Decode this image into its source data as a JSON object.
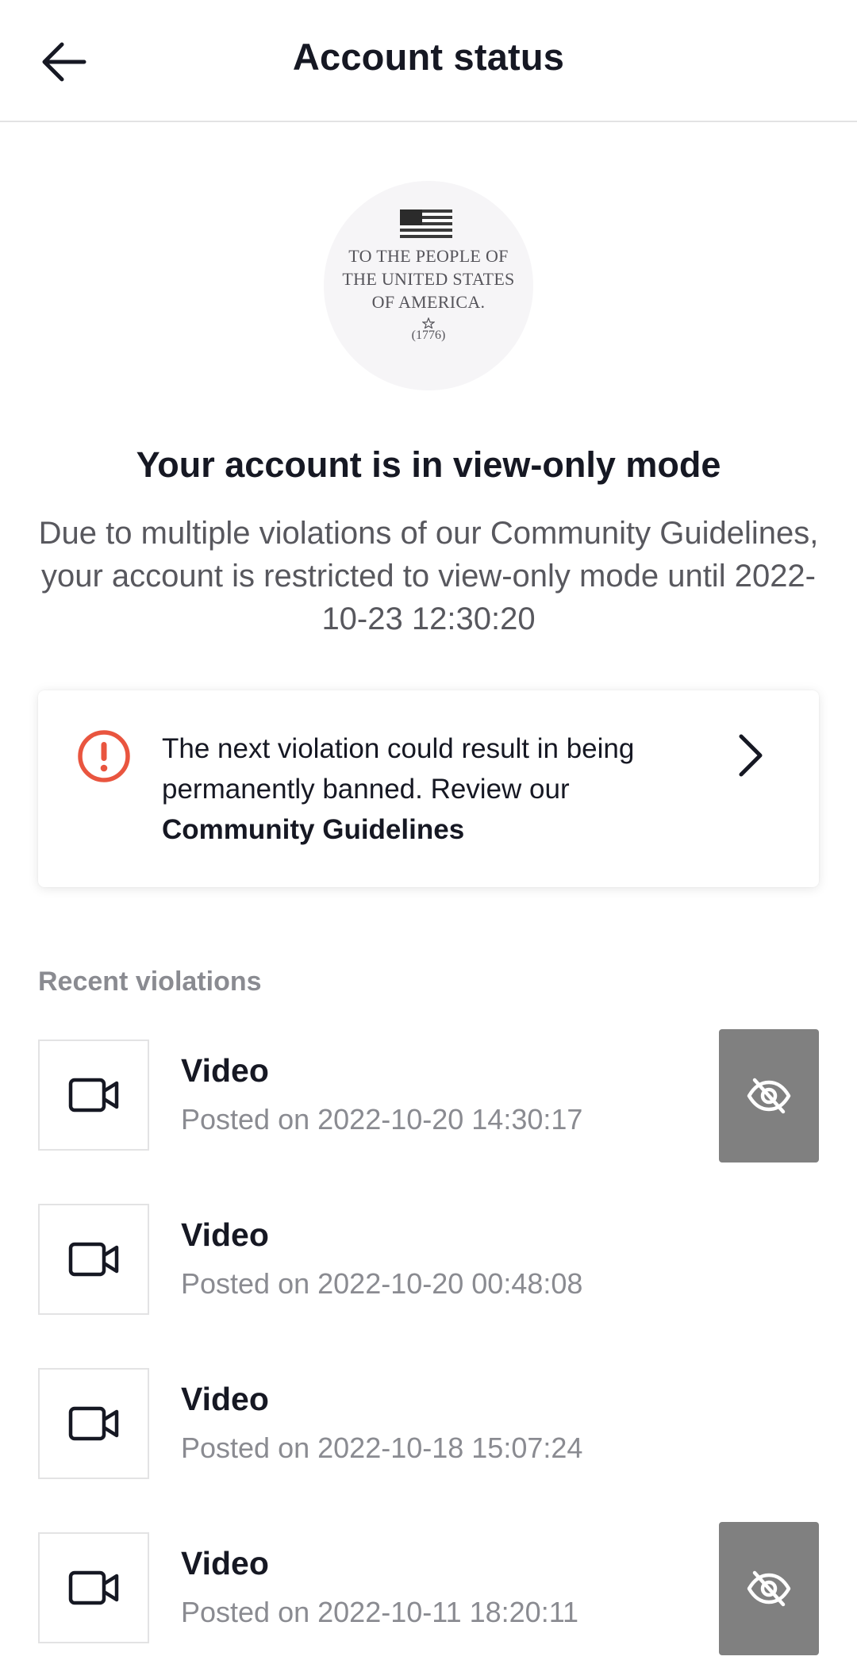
{
  "header": {
    "title": "Account status",
    "back_icon": "arrow-left-icon"
  },
  "avatar": {
    "line1": "TO THE PEOPLE OF",
    "line2": "THE UNITED STATES",
    "line3": "OF AMERICA.",
    "year": "(1776)"
  },
  "status": {
    "title": "Your account is in view-only mode",
    "description": "Due to multiple violations of our Community Guidelines, your account is restricted to view-only mode until 2022-10-23 12:30:20"
  },
  "warning": {
    "text_prefix": "The next violation could result in being permanently banned. Review our ",
    "link_text": "Community Guidelines",
    "icon": "alert-circle-icon",
    "color": "#e9553f"
  },
  "violations": {
    "label": "Recent violations",
    "items": [
      {
        "title": "Video",
        "date": "Posted on 2022-10-20 14:30:17",
        "hidden": true
      },
      {
        "title": "Video",
        "date": "Posted on 2022-10-20 00:48:08",
        "hidden": false
      },
      {
        "title": "Video",
        "date": "Posted on 2022-10-18 15:07:24",
        "hidden": false
      },
      {
        "title": "Video",
        "date": "Posted on 2022-10-11 18:20:11",
        "hidden": true
      }
    ]
  }
}
